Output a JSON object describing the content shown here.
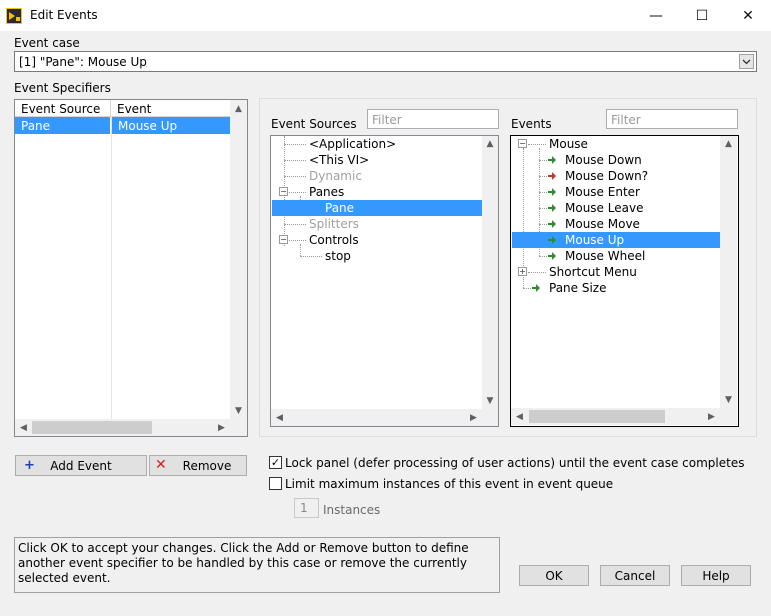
{
  "window": {
    "title": "Edit Events",
    "min_glyph": "—",
    "max_glyph": "☐",
    "close_glyph": "✕"
  },
  "event_case": {
    "label": "Event case",
    "value": "[1] \"Pane\": Mouse Up"
  },
  "event_specifiers": {
    "label": "Event Specifiers",
    "columns": [
      "Event Source",
      "Event"
    ],
    "rows": [
      {
        "source": "Pane",
        "event": "Mouse Up"
      }
    ]
  },
  "event_sources": {
    "label": "Event Sources",
    "filter_placeholder": "Filter",
    "items": [
      {
        "label": "<Application>"
      },
      {
        "label": "<This VI>"
      },
      {
        "label": "Dynamic"
      },
      {
        "label": "Panes"
      },
      {
        "label": "Pane"
      },
      {
        "label": "Splitters"
      },
      {
        "label": "Controls"
      },
      {
        "label": "stop"
      }
    ]
  },
  "events": {
    "label": "Events",
    "filter_placeholder": "Filter",
    "items": [
      {
        "label": "Mouse"
      },
      {
        "label": "Mouse Down"
      },
      {
        "label": "Mouse Down?"
      },
      {
        "label": "Mouse Enter"
      },
      {
        "label": "Mouse Leave"
      },
      {
        "label": "Mouse Move"
      },
      {
        "label": "Mouse Up"
      },
      {
        "label": "Mouse Wheel"
      },
      {
        "label": "Shortcut Menu"
      },
      {
        "label": "Pane Size"
      }
    ]
  },
  "buttons": {
    "add_event": "Add Event",
    "remove": "Remove",
    "ok": "OK",
    "cancel": "Cancel",
    "help": "Help"
  },
  "options": {
    "lock_panel": "Lock panel (defer processing of user actions) until the event case completes",
    "lock_panel_checked": "✓",
    "limit_instances": "Limit maximum instances of this event in event queue",
    "instances_value": "1",
    "instances_label": "Instances"
  },
  "help_text": "Click OK to accept your changes.  Click the Add or Remove button to define another event specifier to be handled by this case or remove the currently selected event.",
  "colors": {
    "selection": "#3399ff",
    "event_arrow": "#2e8b2e",
    "filter_arrow": "#c0392b"
  }
}
